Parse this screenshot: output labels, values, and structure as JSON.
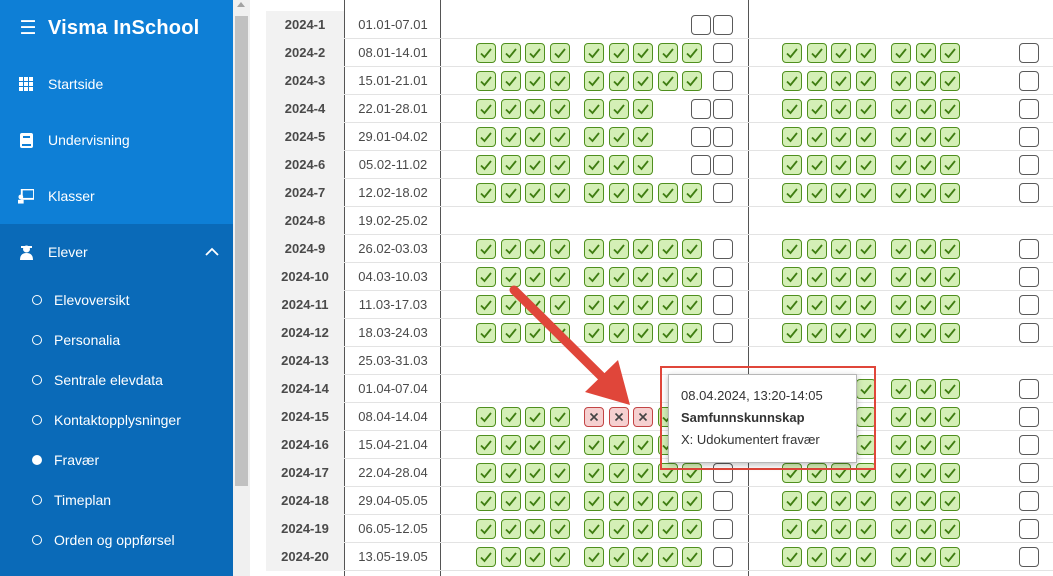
{
  "app": {
    "title": "Visma InSchool"
  },
  "sidebar": {
    "items": [
      {
        "label": "Startside",
        "icon": "grid-icon"
      },
      {
        "label": "Undervisning",
        "icon": "book-icon"
      },
      {
        "label": "Klasser",
        "icon": "board-icon"
      },
      {
        "label": "Elever",
        "icon": "students-icon",
        "expanded": true
      }
    ],
    "subitems": [
      {
        "label": "Elevoversikt",
        "active": false
      },
      {
        "label": "Personalia",
        "active": false
      },
      {
        "label": "Sentrale elevdata",
        "active": false
      },
      {
        "label": "Kontaktopplysninger",
        "active": false
      },
      {
        "label": "Fravær",
        "active": true
      },
      {
        "label": "Timeplan",
        "active": false
      },
      {
        "label": "Orden og oppførsel",
        "active": false
      }
    ]
  },
  "colors": {
    "present": "#d4efb6",
    "absent": "#f6d0d0",
    "accent": "#0e7fd6"
  },
  "weeks": [
    {
      "week": "2024-1",
      "dates": "01.01-07.01",
      "g1": "",
      "g2": "",
      "e": "ee",
      "g3": "",
      "g4": "",
      "last": ""
    },
    {
      "week": "2024-2",
      "dates": "08.01-14.01",
      "g1": "gggg",
      "g2": "ggggg",
      "e": "e",
      "g3": "gggg",
      "g4": "ggg",
      "last": "e"
    },
    {
      "week": "2024-3",
      "dates": "15.01-21.01",
      "g1": "gggg",
      "g2": "ggggg",
      "e": "e",
      "g3": "gggg",
      "g4": "ggg",
      "last": "e"
    },
    {
      "week": "2024-4",
      "dates": "22.01-28.01",
      "g1": "gggg",
      "g2": "ggg",
      "e": "ee",
      "g3": "gggg",
      "g4": "ggg",
      "last": "e"
    },
    {
      "week": "2024-5",
      "dates": "29.01-04.02",
      "g1": "gggg",
      "g2": "ggg",
      "e": "ee",
      "g3": "gggg",
      "g4": "ggg",
      "last": "e"
    },
    {
      "week": "2024-6",
      "dates": "05.02-11.02",
      "g1": "gggg",
      "g2": "ggg",
      "e": "ee",
      "g3": "gggg",
      "g4": "ggg",
      "last": "e"
    },
    {
      "week": "2024-7",
      "dates": "12.02-18.02",
      "g1": "gggg",
      "g2": "ggggg",
      "e": "e",
      "g3": "gggg",
      "g4": "ggg",
      "last": "e"
    },
    {
      "week": "2024-8",
      "dates": "19.02-25.02",
      "g1": "",
      "g2": "",
      "e": "",
      "g3": "",
      "g4": "",
      "last": ""
    },
    {
      "week": "2024-9",
      "dates": "26.02-03.03",
      "g1": "gggg",
      "g2": "ggggg",
      "e": "e",
      "g3": "gggg",
      "g4": "ggg",
      "last": "e"
    },
    {
      "week": "2024-10",
      "dates": "04.03-10.03",
      "g1": "gggg",
      "g2": "ggggg",
      "e": "e",
      "g3": "gggg",
      "g4": "ggg",
      "last": "e"
    },
    {
      "week": "2024-11",
      "dates": "11.03-17.03",
      "g1": "gggg",
      "g2": "ggggg",
      "e": "e",
      "g3": "gggg",
      "g4": "ggg",
      "last": "e"
    },
    {
      "week": "2024-12",
      "dates": "18.03-24.03",
      "g1": "gggg",
      "g2": "ggggg",
      "e": "e",
      "g3": "gggg",
      "g4": "ggg",
      "last": "e"
    },
    {
      "week": "2024-13",
      "dates": "25.03-31.03",
      "g1": "",
      "g2": "",
      "e": "",
      "g3": "",
      "g4": "",
      "last": ""
    },
    {
      "week": "2024-14",
      "dates": "01.04-07.04",
      "g1": "",
      "g2": "",
      "e": "",
      "g3": "gggg",
      "g4": "ggg",
      "last": "e"
    },
    {
      "week": "2024-15",
      "dates": "08.04-14.04",
      "g1": "gggg",
      "g2": "xxxgg",
      "e": "e",
      "g3": "gggg",
      "g4": "ggg",
      "last": "e"
    },
    {
      "week": "2024-16",
      "dates": "15.04-21.04",
      "g1": "gggg",
      "g2": "ggggg",
      "e": "e",
      "g3": "gggg",
      "g4": "ggg",
      "last": "e"
    },
    {
      "week": "2024-17",
      "dates": "22.04-28.04",
      "g1": "gggg",
      "g2": "ggggg",
      "e": "e",
      "g3": "gggg",
      "g4": "ggg",
      "last": "e"
    },
    {
      "week": "2024-18",
      "dates": "29.04-05.05",
      "g1": "gggg",
      "g2": "ggggg",
      "e": "e",
      "g3": "gggg",
      "g4": "ggg",
      "last": "e"
    },
    {
      "week": "2024-19",
      "dates": "06.05-12.05",
      "g1": "gggg",
      "g2": "ggggg",
      "e": "e",
      "g3": "gggg",
      "g4": "ggg",
      "last": "e"
    },
    {
      "week": "2024-20",
      "dates": "13.05-19.05",
      "g1": "gggg",
      "g2": "ggggg",
      "e": "e",
      "g3": "gggg",
      "g4": "ggg",
      "last": "e"
    }
  ],
  "tooltip": {
    "time": "08.04.2024, 13:20-14:05",
    "subject": "Samfunnskunnskap",
    "code": "X: Udokumentert fravær"
  }
}
